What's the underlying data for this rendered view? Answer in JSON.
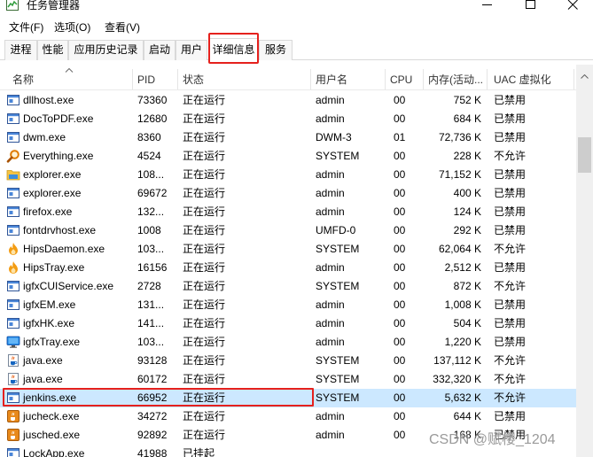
{
  "window": {
    "title": "任务管理器",
    "icon": "task-manager-icon",
    "controls": [
      "minimize-icon",
      "maximize-icon",
      "close-icon"
    ]
  },
  "menu": [
    {
      "label": "文件(F)"
    },
    {
      "label": "选项(O)"
    },
    {
      "label": "查看(V)"
    }
  ],
  "tabs": [
    {
      "label": "进程",
      "selected": false
    },
    {
      "label": "性能",
      "selected": false
    },
    {
      "label": "应用历史记录",
      "selected": false
    },
    {
      "label": "启动",
      "selected": false
    },
    {
      "label": "用户",
      "selected": false
    },
    {
      "label": "详细信息",
      "selected": true,
      "annotated": true
    },
    {
      "label": "服务",
      "selected": false
    }
  ],
  "table": {
    "columns": [
      {
        "label": "名称",
        "sort_icon": "sort-ascending-icon"
      },
      {
        "label": "PID"
      },
      {
        "label": "状态"
      },
      {
        "label": "用户名"
      },
      {
        "label": "CPU"
      },
      {
        "label": "内存(活动..."
      },
      {
        "label": "UAC 虚拟化"
      }
    ],
    "rows": [
      {
        "icon": "app-window-icon",
        "name": "dllhost.exe",
        "pid": "73360",
        "status": "正在运行",
        "user": "admin",
        "cpu": "00",
        "memory": "752 K",
        "uac": "已禁用"
      },
      {
        "icon": "app-window-icon",
        "name": "DocToPDF.exe",
        "pid": "12680",
        "status": "正在运行",
        "user": "admin",
        "cpu": "00",
        "memory": "684 K",
        "uac": "已禁用"
      },
      {
        "icon": "app-window-icon",
        "name": "dwm.exe",
        "pid": "8360",
        "status": "正在运行",
        "user": "DWM-3",
        "cpu": "01",
        "memory": "72,736 K",
        "uac": "已禁用"
      },
      {
        "icon": "magnifier-icon",
        "name": "Everything.exe",
        "pid": "4524",
        "status": "正在运行",
        "user": "SYSTEM",
        "cpu": "00",
        "memory": "228 K",
        "uac": "不允许"
      },
      {
        "icon": "folder-icon",
        "name": "explorer.exe",
        "pid": "108...",
        "status": "正在运行",
        "user": "admin",
        "cpu": "00",
        "memory": "71,152 K",
        "uac": "已禁用"
      },
      {
        "icon": "app-window-icon",
        "name": "explorer.exe",
        "pid": "69672",
        "status": "正在运行",
        "user": "admin",
        "cpu": "00",
        "memory": "400 K",
        "uac": "已禁用"
      },
      {
        "icon": "app-window-icon",
        "name": "firefox.exe",
        "pid": "132...",
        "status": "正在运行",
        "user": "admin",
        "cpu": "00",
        "memory": "124 K",
        "uac": "已禁用"
      },
      {
        "icon": "app-window-icon",
        "name": "fontdrvhost.exe",
        "pid": "1008",
        "status": "正在运行",
        "user": "UMFD-0",
        "cpu": "00",
        "memory": "292 K",
        "uac": "已禁用"
      },
      {
        "icon": "flame-icon",
        "name": "HipsDaemon.exe",
        "pid": "103...",
        "status": "正在运行",
        "user": "SYSTEM",
        "cpu": "00",
        "memory": "62,064 K",
        "uac": "不允许"
      },
      {
        "icon": "flame-icon",
        "name": "HipsTray.exe",
        "pid": "16156",
        "status": "正在运行",
        "user": "admin",
        "cpu": "00",
        "memory": "2,512 K",
        "uac": "已禁用"
      },
      {
        "icon": "app-window-icon",
        "name": "igfxCUIService.exe",
        "pid": "2728",
        "status": "正在运行",
        "user": "SYSTEM",
        "cpu": "00",
        "memory": "872 K",
        "uac": "不允许"
      },
      {
        "icon": "app-window-icon",
        "name": "igfxEM.exe",
        "pid": "131...",
        "status": "正在运行",
        "user": "admin",
        "cpu": "00",
        "memory": "1,008 K",
        "uac": "已禁用"
      },
      {
        "icon": "app-window-icon",
        "name": "igfxHK.exe",
        "pid": "141...",
        "status": "正在运行",
        "user": "admin",
        "cpu": "00",
        "memory": "504 K",
        "uac": "已禁用"
      },
      {
        "icon": "monitor-icon",
        "name": "igfxTray.exe",
        "pid": "103...",
        "status": "正在运行",
        "user": "admin",
        "cpu": "00",
        "memory": "1,220 K",
        "uac": "已禁用"
      },
      {
        "icon": "java-icon",
        "name": "java.exe",
        "pid": "93128",
        "status": "正在运行",
        "user": "SYSTEM",
        "cpu": "00",
        "memory": "137,112 K",
        "uac": "不允许"
      },
      {
        "icon": "java-icon",
        "name": "java.exe",
        "pid": "60172",
        "status": "正在运行",
        "user": "SYSTEM",
        "cpu": "00",
        "memory": "332,320 K",
        "uac": "不允许"
      },
      {
        "icon": "app-window-icon",
        "name": "jenkins.exe",
        "pid": "66952",
        "status": "正在运行",
        "user": "SYSTEM",
        "cpu": "00",
        "memory": "5,632 K",
        "uac": "不允许",
        "selected": true,
        "annotated": true
      },
      {
        "icon": "java-update-icon",
        "name": "jucheck.exe",
        "pid": "34272",
        "status": "正在运行",
        "user": "admin",
        "cpu": "00",
        "memory": "644 K",
        "uac": "已禁用"
      },
      {
        "icon": "java-update-icon",
        "name": "jusched.exe",
        "pid": "92892",
        "status": "正在运行",
        "user": "admin",
        "cpu": "00",
        "memory": "168 K",
        "uac": "已禁用"
      },
      {
        "icon": "app-window-icon",
        "name": "LockApp.exe",
        "pid": "41988",
        "status": "已挂起"
      }
    ]
  },
  "scrollbar": {
    "up_icon": "chevron-up-icon"
  },
  "colors": {
    "selected_row": "#cce8ff",
    "annotation_box": "#e5211d",
    "header_separator": "#e5e5e5"
  },
  "watermark": "CSDN @赋楼_1204"
}
